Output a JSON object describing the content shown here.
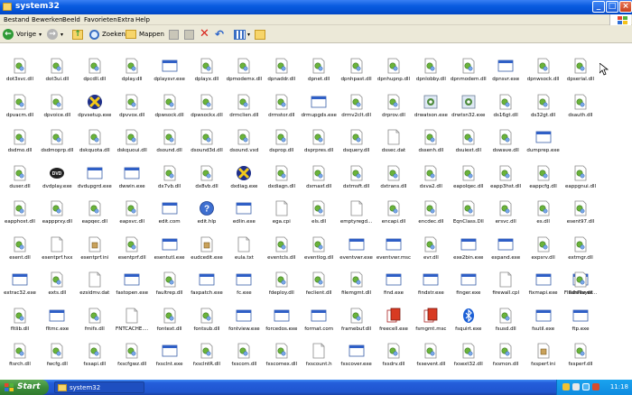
{
  "window": {
    "title": "system32"
  },
  "menu": [
    "Bestand",
    "Bewerken",
    "Beeld",
    "Favorieten",
    "Extra",
    "Help"
  ],
  "toolbar": {
    "back": "Vorige",
    "search": "Zoeken",
    "folders": "Mappen"
  },
  "taskbar": {
    "start": "Start",
    "task": "system32",
    "clock": "11:18"
  },
  "rows": [
    [
      {
        "n": "dot3svc.dll",
        "t": "dll"
      },
      {
        "n": "dot3ui.dll",
        "t": "dll"
      },
      {
        "n": "dpcdll.dll",
        "t": "dll"
      },
      {
        "n": "dplay.dll",
        "t": "dll"
      },
      {
        "n": "dplaysvr.exe",
        "t": "exe"
      },
      {
        "n": "dplayx.dll",
        "t": "dll"
      },
      {
        "n": "dpmodemx.dll",
        "t": "dll"
      },
      {
        "n": "dpnaddr.dll",
        "t": "dll"
      },
      {
        "n": "dpnet.dll",
        "t": "dll"
      },
      {
        "n": "dpnhpast.dll",
        "t": "dll"
      },
      {
        "n": "dpnhupnp.dll",
        "t": "dll"
      },
      {
        "n": "dpnlobby.dll",
        "t": "dll"
      },
      {
        "n": "dpnmodem.dll",
        "t": "dll"
      },
      {
        "n": "dpnsvr.exe",
        "t": "exe"
      },
      {
        "n": "dpnwsock.dll",
        "t": "dll"
      },
      {
        "n": "dpserial.dll",
        "t": "dll"
      }
    ],
    [
      {
        "n": "dpvacm.dll",
        "t": "dll"
      },
      {
        "n": "dpvoice.dll",
        "t": "dll"
      },
      {
        "n": "dpvsetup.exe",
        "t": "dx"
      },
      {
        "n": "dpvvox.dll",
        "t": "dll"
      },
      {
        "n": "dpwsock.dll",
        "t": "dll"
      },
      {
        "n": "dpwsockx.dll",
        "t": "dll"
      },
      {
        "n": "drmclien.dll",
        "t": "dll"
      },
      {
        "n": "drmstor.dll",
        "t": "dll"
      },
      {
        "n": "drmupgds.exe",
        "t": "exe"
      },
      {
        "n": "drmv2clt.dll",
        "t": "dll"
      },
      {
        "n": "drprov.dll",
        "t": "dll"
      },
      {
        "n": "drwatson.exe",
        "t": "doc"
      },
      {
        "n": "drwtsn32.exe",
        "t": "doc"
      },
      {
        "n": "ds16gt.dll",
        "t": "dll"
      },
      {
        "n": "ds32gt.dll",
        "t": "dll"
      },
      {
        "n": "dsauth.dll",
        "t": "dll"
      }
    ],
    [
      {
        "n": "dsdmo.dll",
        "t": "dll"
      },
      {
        "n": "dsdmoprp.dll",
        "t": "dll"
      },
      {
        "n": "dskquota.dll",
        "t": "dll"
      },
      {
        "n": "dskquoui.dll",
        "t": "dll"
      },
      {
        "n": "dsound.dll",
        "t": "dll"
      },
      {
        "n": "dsound3d.dll",
        "t": "dll"
      },
      {
        "n": "dsound.vxd",
        "t": "dll"
      },
      {
        "n": "dsprop.dll",
        "t": "dll"
      },
      {
        "n": "dsprpres.dll",
        "t": "dll"
      },
      {
        "n": "dsquery.dll",
        "t": "dll"
      },
      {
        "n": "dssec.dat",
        "t": "dat"
      },
      {
        "n": "dssenh.dll",
        "t": "dll"
      },
      {
        "n": "dsuiext.dll",
        "t": "dll"
      },
      {
        "n": "dswave.dll",
        "t": "dll"
      },
      {
        "n": "dumprep.exe",
        "t": "exe"
      },
      {
        "n": "",
        "t": "none"
      }
    ],
    [
      {
        "n": "duser.dll",
        "t": "dll"
      },
      {
        "n": "dvdplay.exe",
        "t": "dvd"
      },
      {
        "n": "dvdupgrd.exe",
        "t": "exe"
      },
      {
        "n": "dwwin.exe",
        "t": "exe"
      },
      {
        "n": "dx7vb.dll",
        "t": "dll"
      },
      {
        "n": "dx8vb.dll",
        "t": "dll"
      },
      {
        "n": "dxdiag.exe",
        "t": "dx"
      },
      {
        "n": "dxdiagn.dll",
        "t": "dll"
      },
      {
        "n": "dxmasf.dll",
        "t": "dll"
      },
      {
        "n": "dxtmsft.dll",
        "t": "dll"
      },
      {
        "n": "dxtrans.dll",
        "t": "dll"
      },
      {
        "n": "dxva2.dll",
        "t": "dll"
      },
      {
        "n": "eapolqec.dll",
        "t": "dll"
      },
      {
        "n": "eapp3hst.dll",
        "t": "dll"
      },
      {
        "n": "eappcfg.dll",
        "t": "dll"
      },
      {
        "n": "eappgnui.dll",
        "t": "dll"
      }
    ],
    [
      {
        "n": "eapphost.dll",
        "t": "dll"
      },
      {
        "n": "eappprxy.dll",
        "t": "dll"
      },
      {
        "n": "eapqec.dll",
        "t": "dll"
      },
      {
        "n": "eapsvc.dll",
        "t": "dll"
      },
      {
        "n": "edit.com",
        "t": "exe"
      },
      {
        "n": "edit.hlp",
        "t": "hlp"
      },
      {
        "n": "edlin.exe",
        "t": "exe"
      },
      {
        "n": "ega.cpi",
        "t": "dat"
      },
      {
        "n": "els.dll",
        "t": "dll"
      },
      {
        "n": "emptyregd...",
        "t": "dat"
      },
      {
        "n": "encapi.dll",
        "t": "dll"
      },
      {
        "n": "encdec.dll",
        "t": "dll"
      },
      {
        "n": "EqnClass.Dll",
        "t": "dll"
      },
      {
        "n": "ersvc.dll",
        "t": "dll"
      },
      {
        "n": "es.dll",
        "t": "dll"
      },
      {
        "n": "esent97.dll",
        "t": "dll"
      }
    ],
    [
      {
        "n": "esent.dll",
        "t": "dll"
      },
      {
        "n": "esentprf.hxx",
        "t": "dat"
      },
      {
        "n": "esentprf.ini",
        "t": "ini"
      },
      {
        "n": "esentprf.dll",
        "t": "dll"
      },
      {
        "n": "esentutl.exe",
        "t": "exe"
      },
      {
        "n": "eudcedit.exe",
        "t": "ini"
      },
      {
        "n": "eula.txt",
        "t": "dat"
      },
      {
        "n": "eventcls.dll",
        "t": "dll"
      },
      {
        "n": "eventlog.dll",
        "t": "dll"
      },
      {
        "n": "eventvwr.exe",
        "t": "exe"
      },
      {
        "n": "eventvwr.msc",
        "t": "exe"
      },
      {
        "n": "evr.dll",
        "t": "dll"
      },
      {
        "n": "exe2bin.exe",
        "t": "exe"
      },
      {
        "n": "expand.exe",
        "t": "exe"
      },
      {
        "n": "expsrv.dll",
        "t": "dll"
      },
      {
        "n": "extmgr.dll",
        "t": "dll"
      }
    ],
    [
      {
        "n": "extrac32.exe",
        "t": "exe"
      },
      {
        "n": "exts.dll",
        "t": "dll"
      },
      {
        "n": "ezsidmv.dat",
        "t": "dat"
      },
      {
        "n": "fastopen.exe",
        "t": "exe"
      },
      {
        "n": "faultrep.dll",
        "t": "dll"
      },
      {
        "n": "faxpatch.exe",
        "t": "exe"
      },
      {
        "n": "fc.exe",
        "t": "exe"
      },
      {
        "n": "fdeploy.dll",
        "t": "dll"
      },
      {
        "n": "feclient.dll",
        "t": "dll"
      },
      {
        "n": "filemgmt.dll",
        "t": "dll"
      },
      {
        "n": "find.exe",
        "t": "exe"
      },
      {
        "n": "findstr.exe",
        "t": "exe"
      },
      {
        "n": "finger.exe",
        "t": "exe"
      },
      {
        "n": "firewall.cpl",
        "t": "dat"
      },
      {
        "n": "fixmapi.exe",
        "t": "exe"
      },
      {
        "n": "FlashPlayer...",
        "t": "exe"
      }
    ],
    [
      {
        "n": "fltlib.dll",
        "t": "dll"
      },
      {
        "n": "fltmc.exe",
        "t": "exe"
      },
      {
        "n": "fmifs.dll",
        "t": "dll"
      },
      {
        "n": "FNTCACHE....",
        "t": "dat"
      },
      {
        "n": "fontext.dll",
        "t": "dll"
      },
      {
        "n": "fontsub.dll",
        "t": "dll"
      },
      {
        "n": "fontview.exe",
        "t": "exe"
      },
      {
        "n": "forcedos.exe",
        "t": "exe"
      },
      {
        "n": "format.com",
        "t": "exe"
      },
      {
        "n": "framebuf.dll",
        "t": "dll"
      },
      {
        "n": "freecell.exe",
        "t": "card"
      },
      {
        "n": "fsmgmt.msc",
        "t": "card"
      },
      {
        "n": "fsquirt.exe",
        "t": "bt"
      },
      {
        "n": "fsusd.dll",
        "t": "dll"
      },
      {
        "n": "fsutil.exe",
        "t": "exe"
      },
      {
        "n": "ftp.exe",
        "t": "exe"
      }
    ],
    [
      {
        "n": "ftsrch.dll",
        "t": "dll"
      },
      {
        "n": "fwcfg.dll",
        "t": "dll"
      },
      {
        "n": "fxsapi.dll",
        "t": "dll"
      },
      {
        "n": "fxscfgwz.dll",
        "t": "dll"
      },
      {
        "n": "fxsclnt.exe",
        "t": "exe"
      },
      {
        "n": "fxsclntR.dll",
        "t": "dll"
      },
      {
        "n": "fxscom.dll",
        "t": "dll"
      },
      {
        "n": "fxscomex.dll",
        "t": "dll"
      },
      {
        "n": "fxscount.h",
        "t": "dat"
      },
      {
        "n": "fxscover.exe",
        "t": "exe"
      },
      {
        "n": "fxsdrv.dll",
        "t": "dll"
      },
      {
        "n": "fxsevent.dll",
        "t": "dll"
      },
      {
        "n": "fxsext32.dll",
        "t": "dll"
      },
      {
        "n": "fxsmon.dll",
        "t": "dll"
      },
      {
        "n": "fxsperf.ini",
        "t": "ini"
      },
      {
        "n": "fxsperf.dll",
        "t": "dll"
      }
    ]
  ],
  "extra_rows": {
    "row3_col15": {
      "n": "",
      "t": "none"
    },
    "row6_col15_next": {
      "n": "fldrclnr.dll",
      "t": "dll"
    }
  }
}
